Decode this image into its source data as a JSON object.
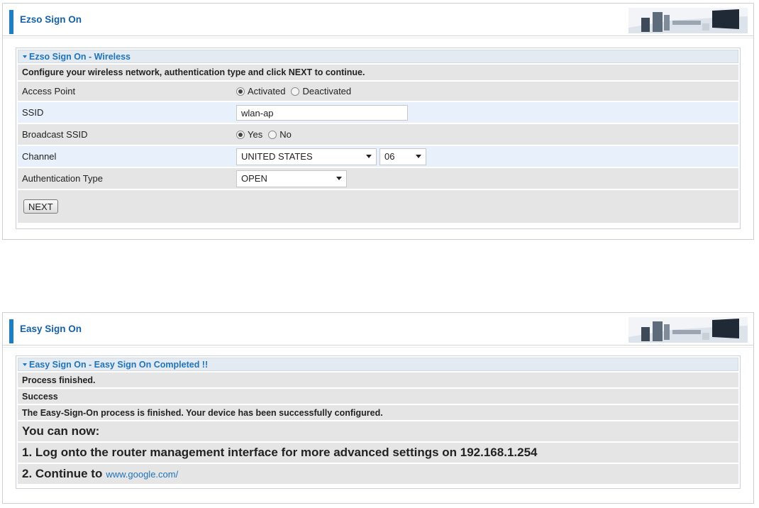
{
  "panel1": {
    "header_title": "Ezso Sign On",
    "section_title": "Ezso Sign On - Wireless",
    "intro": "Configure your wireless network, authentication type and click NEXT to continue.",
    "access_point": {
      "label": "Access Point",
      "options": [
        "Activated",
        "Deactivated"
      ],
      "selected": "Activated"
    },
    "ssid": {
      "label": "SSID",
      "value": "wlan-ap"
    },
    "broadcast_ssid": {
      "label": "Broadcast SSID",
      "options": [
        "Yes",
        "No"
      ],
      "selected": "Yes"
    },
    "channel": {
      "label": "Channel",
      "country": "UNITED STATES",
      "number": "06"
    },
    "auth_type": {
      "label": "Authentication Type",
      "value": "OPEN"
    },
    "next_button": "NEXT"
  },
  "panel2": {
    "header_title": "Easy Sign On",
    "section_title": "Easy Sign On - Easy Sign On Completed !!",
    "line1": "Process finished.",
    "line2": "Success",
    "line3": "The Easy-Sign-On process is finished. Your device has been successfully configured.",
    "line4": "You can now:",
    "line5": "1. Log onto the router management interface for more advanced settings on 192.168.1.254",
    "line6_prefix": "2. Continue to",
    "line6_link": "www.google.com/"
  },
  "colors": {
    "accent": "#1a7fc4",
    "title_text": "#1561a8",
    "link": "#1e74bc",
    "row_grey": "#e5e5e5",
    "row_blue": "#e8f1fb"
  },
  "icons": {
    "banner": "office-desk-monitor-banner",
    "section_toggle": "triangle-down-icon"
  }
}
